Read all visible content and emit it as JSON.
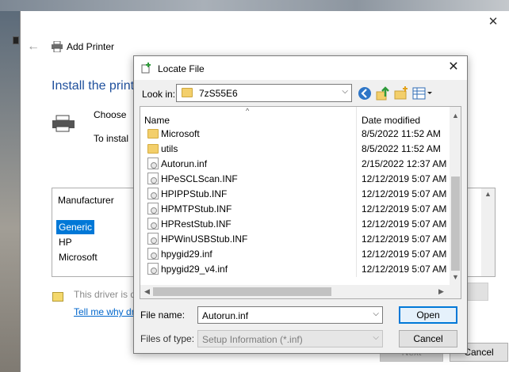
{
  "wizard": {
    "window_title": "Add Printer",
    "heading": "Install the print",
    "choose_text": "Choose",
    "to_install_text": "To instal",
    "manufacturer_header": "Manufacturer",
    "manufacturers": [
      "Generic",
      "HP",
      "Microsoft"
    ],
    "selected_manufacturer": "Generic",
    "driver_note": "This driver is d",
    "link_text": "Tell me why dr",
    "next_label": "Next",
    "cancel_label": "Cancel",
    "close_glyph": "✕",
    "back_glyph": "←"
  },
  "dialog": {
    "title": "Locate File",
    "close_glyph": "✕",
    "look_in_label": "Look in:",
    "look_in_value": "7zS55E6",
    "columns": {
      "name": "Name",
      "date": "Date modified"
    },
    "files": [
      {
        "name": "Microsoft",
        "date": "8/5/2022 11:52 AM",
        "kind": "folder"
      },
      {
        "name": "utils",
        "date": "8/5/2022 11:52 AM",
        "kind": "folder"
      },
      {
        "name": "Autorun.inf",
        "date": "2/15/2022 12:37 AM",
        "kind": "inf"
      },
      {
        "name": "HPeSCLScan.INF",
        "date": "12/12/2019 5:07 AM",
        "kind": "inf"
      },
      {
        "name": "HPIPPStub.INF",
        "date": "12/12/2019 5:07 AM",
        "kind": "inf"
      },
      {
        "name": "HPMTPStub.INF",
        "date": "12/12/2019 5:07 AM",
        "kind": "inf"
      },
      {
        "name": "HPRestStub.INF",
        "date": "12/12/2019 5:07 AM",
        "kind": "inf"
      },
      {
        "name": "HPWinUSBStub.INF",
        "date": "12/12/2019 5:07 AM",
        "kind": "inf"
      },
      {
        "name": "hpygid29.inf",
        "date": "12/12/2019 5:07 AM",
        "kind": "inf"
      },
      {
        "name": "hpygid29_v4.inf",
        "date": "12/12/2019 5:07 AM",
        "kind": "inf"
      }
    ],
    "file_name_label": "File name:",
    "file_name_value": "Autorun.inf",
    "files_of_type_label": "Files of type:",
    "files_of_type_value": "Setup Information (*.inf)",
    "open_label": "Open",
    "cancel_label": "Cancel"
  },
  "colors": {
    "accent": "#0078d7",
    "heading_blue": "#1e4f9c",
    "link": "#0066cc",
    "folder": "#f3cf6b"
  }
}
